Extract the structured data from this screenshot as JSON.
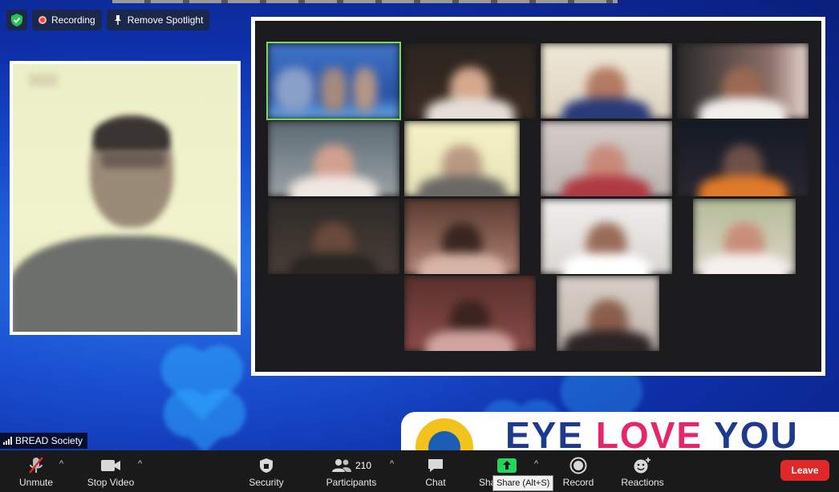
{
  "top_bar": {
    "recording_label": "Recording",
    "remove_spotlight_label": "Remove Spotlight"
  },
  "speaker": {
    "name": "BREAD Society"
  },
  "banner": {
    "text_a": "EYE ",
    "text_love": "LOVE",
    "text_b": " YOU"
  },
  "toolbar": {
    "unmute": "Unmute",
    "stop_video": "Stop Video",
    "security": "Security",
    "participants": "Participants",
    "participants_count": "210",
    "chat": "Chat",
    "share": "Sha",
    "share_tooltip": "Share (Alt+S)",
    "record": "Record",
    "reactions": "Reactions",
    "leave": "Leave"
  },
  "colors": {
    "leave": "#e02828",
    "share_green": "#27d35b",
    "accent_blue": "#1a4fd0"
  }
}
